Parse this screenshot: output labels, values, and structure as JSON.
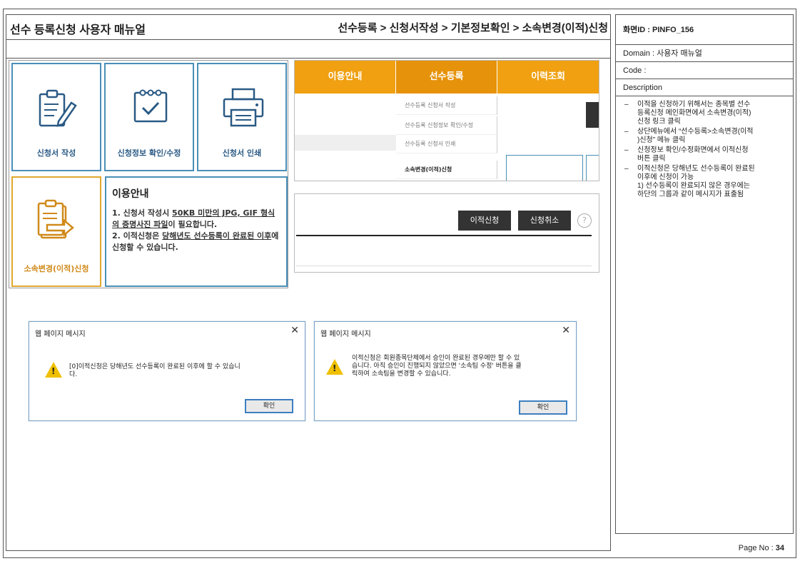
{
  "header": {
    "title": "선수 등록신청 사용자 매뉴얼",
    "breadcrumb": "선수등록 > 신청서작성 > 기본정보확인 > 소속변경(이적)신청"
  },
  "side": {
    "screen_id": "화면ID : PINFO_156",
    "domain": "Domain : 사용자 매뉴얼",
    "code": "Code :",
    "description_label": "Description",
    "items": [
      "이적을 신청하기 위해서는 종목별 선수\n등록신청 메인화면에서 소속변경(이적)\n신청 링크 클릭",
      "상단메뉴에서 “선수등록>소속변경(이적\n)신청” 메뉴 클릭",
      "신청정보 확인/수정화면에서 이적신청\n버튼 클릭",
      "이적신청은 당해년도 선수등록이 완료된\n이후에 신청이 가능\n1) 선수등록이 완료되지 않은 경우에는\n하단의 그룹과 같이 메시지가 표출됨"
    ],
    "page_no_label": "Page No :",
    "page_no": "34"
  },
  "tiles": {
    "apply_write": "신청서 작성",
    "apply_edit": "신청정보 확인/수정",
    "apply_print": "신청서 인쇄",
    "transfer": "소속변경(이적)신청"
  },
  "info": {
    "title": "이용안내",
    "line1a": "1. 신청서 작성시 ",
    "line1b": "50KB 미만의 JPG, GIF 형식의 증명사진 파일",
    "line1c": "이 필요합니다.",
    "line2a": "2. 이적신청은 ",
    "line2b": "당해년도 선수등록이 완료된 이후",
    "line2c": "에 신청할 수 있습니다."
  },
  "menu": {
    "tabs": [
      "이용안내",
      "선수등록",
      "이력조회"
    ],
    "subitems": [
      "선수등록 신청서 작성",
      "선수등록 신청정보 확인/수정",
      "선수등록 신청서 인쇄",
      "소속변경(이적)신청"
    ]
  },
  "actions": {
    "transfer_btn": "이적신청",
    "cancel_btn": "신청취소",
    "help": "?"
  },
  "dialog1": {
    "title": "웹 페이지 메시지",
    "close": "✕",
    "message": "[0]이적신청은 당해년도 선수등록이 완료된 이후에 할 수 있습니\n다.",
    "ok": "확인"
  },
  "dialog2": {
    "title": "웹 페이지 메시지",
    "close": "✕",
    "message": "이적신청은 회원종목단체에서 승인이 완료된 경우에만 할 수 있\n습니다. 아직 승인이 진행되지 않았으면 '소속팀 수정' 버튼을 클\n릭하여 소속팀을 변경할 수 있습니다.",
    "ok": "확인"
  },
  "colors": {
    "orange": "#f0a010",
    "blue": "#4a8fb8",
    "gold": "#e0a82e"
  }
}
